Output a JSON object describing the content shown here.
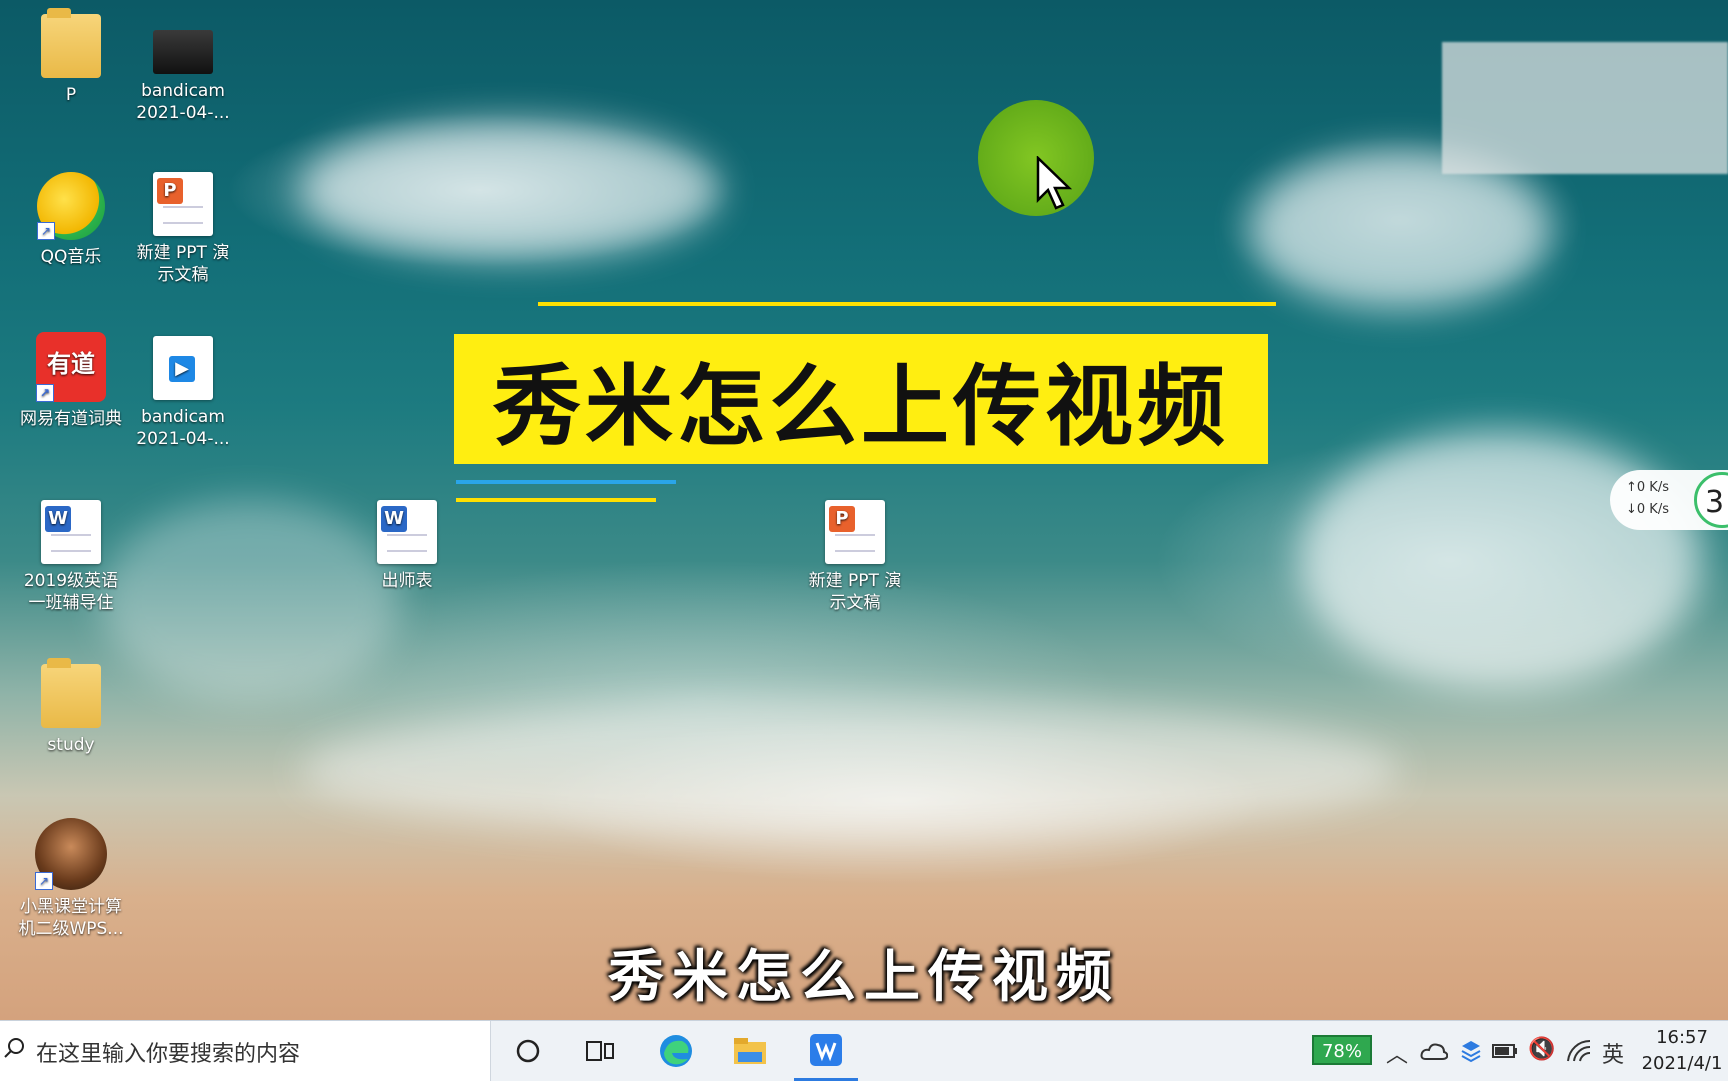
{
  "desktop_icons": [
    {
      "label_line1": "P",
      "label_line2": "",
      "icon": "folder-icon"
    },
    {
      "label_line1": "bandicam",
      "label_line2": "2021-04-...",
      "icon": "video-thumbnail-icon"
    },
    {
      "label_line1": "QQ音乐",
      "label_line2": "",
      "icon": "qq-music-icon"
    },
    {
      "label_line1": "新建 PPT 演",
      "label_line2": "示文稿",
      "icon": "ppt-file-icon"
    },
    {
      "label_line1": "网易有道词典",
      "label_line2": "",
      "icon": "youdao-dictionary-icon",
      "glyph": "有道"
    },
    {
      "label_line1": "bandicam",
      "label_line2": "2021-04-...",
      "icon": "video-file-icon"
    },
    {
      "label_line1": "2019级英语",
      "label_line2": "一班辅导住",
      "icon": "word-file-icon"
    },
    {
      "label_line1": "出师表",
      "label_line2": "",
      "icon": "word-file-icon"
    },
    {
      "label_line1": "新建 PPT 演",
      "label_line2": "示文稿",
      "icon": "ppt-file-icon"
    },
    {
      "label_line1": "study",
      "label_line2": "",
      "icon": "folder-icon"
    },
    {
      "label_line1": "小黑课堂计算",
      "label_line2": "机二级WPS...",
      "icon": "app-avatar-icon"
    }
  ],
  "overlay": {
    "title": "秀米怎么上传视频",
    "subtitle": "秀米怎么上传视频"
  },
  "net_widget": {
    "up": "↑0  K/s",
    "down": "↓0  K/s",
    "gauge": "3"
  },
  "taskbar": {
    "search_placeholder": "在这里输入你要搜索的内容",
    "battery_percent": "78%",
    "ime": "英",
    "time": "16:57",
    "date": "2021/4/1"
  },
  "colors": {
    "banner": "#ffee11",
    "cursor_highlight": "#8fd11a",
    "taskbar": "#eef2f6"
  }
}
